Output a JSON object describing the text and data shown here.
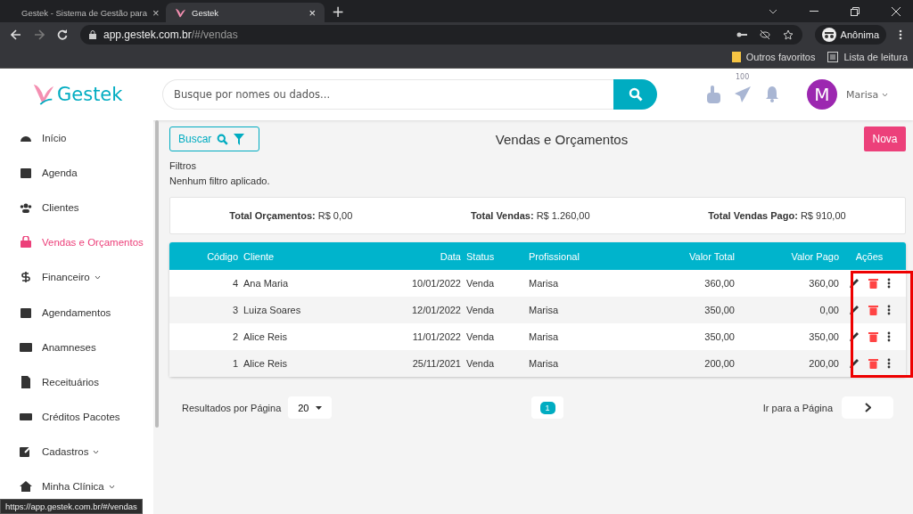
{
  "browser": {
    "tabs": [
      {
        "title": "Gestek - Sistema de Gestão para",
        "close": "×",
        "selected": false
      },
      {
        "title": "Gestek",
        "close": "×",
        "selected": true
      }
    ],
    "new_tab": "+",
    "url_host": "app.gestek.com.br",
    "url_path": "/#/vendas",
    "profile": "Anônima",
    "bookmarks": [
      "Outros favoritos",
      "Lista de leitura"
    ]
  },
  "header": {
    "logo": "Gestek",
    "search_placeholder": "Busque por nomes ou dados...",
    "badge": "100",
    "avatar_letter": "M",
    "user": "Marisa"
  },
  "sidebar": {
    "items": [
      {
        "label": "Início",
        "kind": "gauge",
        "selected": false,
        "expandable": false
      },
      {
        "label": "Agenda",
        "kind": "calendar",
        "selected": false,
        "expandable": false
      },
      {
        "label": "Clientes",
        "kind": "users",
        "selected": false,
        "expandable": false
      },
      {
        "label": "Vendas e Orçamentos",
        "kind": "bag",
        "selected": true,
        "expandable": false
      },
      {
        "label": "Financeiro",
        "kind": "dollar",
        "selected": false,
        "expandable": true
      },
      {
        "label": "Agendamentos",
        "kind": "calendar2",
        "selected": false,
        "expandable": false
      },
      {
        "label": "Anamneses",
        "kind": "card",
        "selected": false,
        "expandable": false
      },
      {
        "label": "Receituários",
        "kind": "file",
        "selected": false,
        "expandable": false
      },
      {
        "label": "Créditos Pacotes",
        "kind": "ticket",
        "selected": false,
        "expandable": false
      },
      {
        "label": "Cadastros",
        "kind": "edit",
        "selected": false,
        "expandable": true
      },
      {
        "label": "Minha Clínica",
        "kind": "home",
        "selected": false,
        "expandable": true
      }
    ]
  },
  "page": {
    "search_button": "Buscar",
    "title": "Vendas e Orçamentos",
    "new_button": "Nova",
    "filters_label": "Filtros",
    "filters_text": "Nenhum filtro aplicado."
  },
  "totals": [
    {
      "label": "Total Orçamentos:",
      "value": "R$ 0,00"
    },
    {
      "label": "Total Vendas:",
      "value": "R$ 1.260,00"
    },
    {
      "label": "Total Vendas Pago:",
      "value": "R$ 910,00"
    }
  ],
  "table": {
    "columns": [
      "Código",
      "Cliente",
      "Data",
      "Status",
      "Profissional",
      "Valor Total",
      "Valor Pago",
      "Ações"
    ],
    "rows": [
      [
        "4",
        "Ana Maria",
        "10/01/2022",
        "Venda",
        "Marisa",
        "360,00",
        "360,00"
      ],
      [
        "3",
        "Luiza Soares",
        "12/01/2022",
        "Venda",
        "Marisa",
        "350,00",
        "0,00"
      ],
      [
        "2",
        "Alice Reis",
        "11/01/2022",
        "Venda",
        "Marisa",
        "350,00",
        "350,00"
      ],
      [
        "1",
        "Alice Reis",
        "25/11/2021",
        "Venda",
        "Marisa",
        "200,00",
        "200,00"
      ]
    ]
  },
  "pagination": {
    "per_page_label": "Resultados por Página",
    "per_page": "20",
    "current_page": "1",
    "goto_label": "Ir para a Página"
  },
  "status_url": "https://app.gestek.com.br/#/vendas"
}
